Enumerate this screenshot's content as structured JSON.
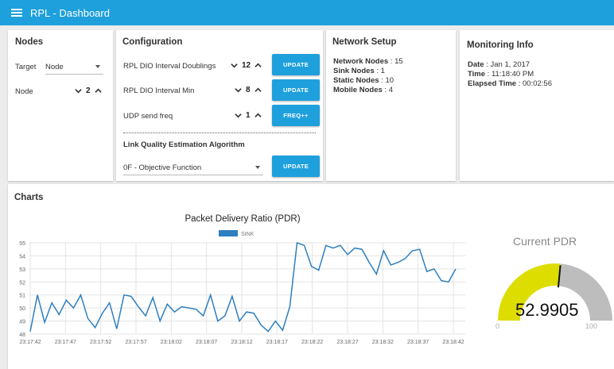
{
  "app": {
    "title": "RPL - Dashboard"
  },
  "nodes": {
    "title": "Nodes",
    "target_label": "Target",
    "target_value": "Node",
    "node_label": "Node",
    "node_value": "2"
  },
  "configuration": {
    "title": "Configuration",
    "rows": [
      {
        "label": "RPL DIO Interval Doublings",
        "value": "12",
        "button": "UPDATE"
      },
      {
        "label": "RPL DIO Interval Min",
        "value": "8",
        "button": "UPDATE"
      },
      {
        "label": "UDP send freq",
        "value": "1",
        "button": "FREQ++"
      }
    ],
    "lqe_title": "Link Quality Estimation Algorithm",
    "lqe_value": "0F - Objective Function",
    "lqe_button": "UPDATE"
  },
  "network": {
    "title": "Network Setup",
    "items": [
      {
        "label": "Network Nodes",
        "value": "15"
      },
      {
        "label": "Sink Nodes",
        "value": "1"
      },
      {
        "label": "Static Nodes",
        "value": "10"
      },
      {
        "label": "Mobile Nodes",
        "value": "4"
      }
    ]
  },
  "monitoring": {
    "title": "Monitoring Info",
    "items": [
      {
        "label": "Date",
        "value": "Jan 1, 2017"
      },
      {
        "label": "Time",
        "value": "11:18:40 PM"
      },
      {
        "label": "Elapsed Time",
        "value": "00:02:56"
      }
    ]
  },
  "charts": {
    "title": "Charts"
  },
  "gauge": {
    "title": "Current PDR",
    "value": "52.9905",
    "value_num": 52.9905,
    "min": "0",
    "max": "100",
    "fill_color": "#dddd00",
    "track_color": "#bdbdbd"
  },
  "chart_data": {
    "type": "line",
    "title": "Packet Delivery Ratio (PDR)",
    "ylim": [
      48,
      55
    ],
    "yticks": [
      "48",
      "49",
      "50",
      "51",
      "52",
      "53",
      "54",
      "55"
    ],
    "xticks": [
      "23:17:42",
      "23:17:47",
      "23:17:52",
      "23:17:57",
      "23:18:02",
      "23:18:07",
      "23:18:12",
      "23:18:17",
      "23:18:22",
      "23:18:27",
      "23:18:32",
      "23:18:37",
      "23:18:42"
    ],
    "grid": true,
    "legend": "top",
    "series": [
      {
        "name": "SINK",
        "color": "#2e7fc0",
        "values": [
          48.2,
          51.0,
          48.9,
          50.4,
          49.5,
          50.6,
          50.0,
          51.0,
          49.2,
          48.5,
          49.6,
          50.4,
          48.4,
          51.0,
          50.9,
          50.1,
          49.4,
          50.8,
          49.0,
          50.3,
          49.7,
          50.1,
          50.0,
          49.9,
          49.4,
          51.0,
          49.0,
          49.4,
          50.9,
          49.0,
          49.7,
          49.6,
          48.7,
          48.2,
          49.0,
          48.3,
          50.1,
          55.0,
          54.8,
          53.2,
          52.9,
          54.8,
          54.6,
          54.8,
          54.1,
          54.6,
          54.5,
          53.5,
          52.6,
          54.4,
          53.3,
          53.5,
          53.8,
          54.4,
          54.5,
          52.8,
          53.0,
          52.1,
          52.0,
          52.99
        ]
      }
    ]
  }
}
